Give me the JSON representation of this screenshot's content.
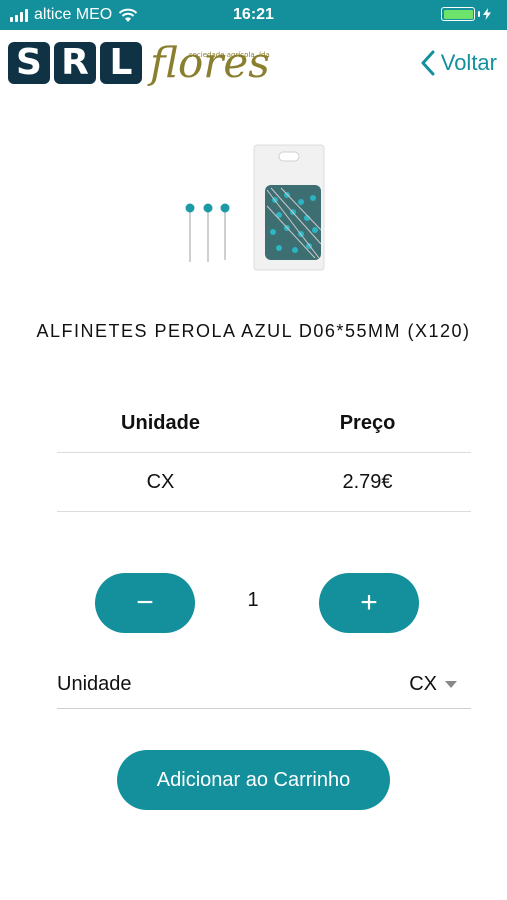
{
  "status_bar": {
    "carrier": "altice MEO",
    "time": "16:21",
    "battery_color": "#6ee36b"
  },
  "header": {
    "logo_letters": [
      "S",
      "R",
      "L"
    ],
    "logo_word": "flores",
    "logo_tagline": "sociedade agrícola, lda",
    "back_label": "Voltar",
    "back_icon": "chevron-left-icon"
  },
  "product": {
    "title": "ALFINETES PEROLA AZUL D06*55MM (X120)",
    "image": "pins-package-image"
  },
  "price_table": {
    "headers": [
      "Unidade",
      "Preço"
    ],
    "rows": [
      [
        "CX",
        "2.79€"
      ]
    ]
  },
  "quantity": {
    "decrement_label": "−",
    "value": "1",
    "increment_label": "+"
  },
  "unit_selector": {
    "label": "Unidade",
    "value": "CX",
    "icon": "caret-down-icon"
  },
  "add_to_cart_label": "Adicionar ao Carrinho",
  "colors": {
    "accent": "#13909c",
    "logo_dark": "#0f3344",
    "logo_olive": "#8a7f2e"
  }
}
